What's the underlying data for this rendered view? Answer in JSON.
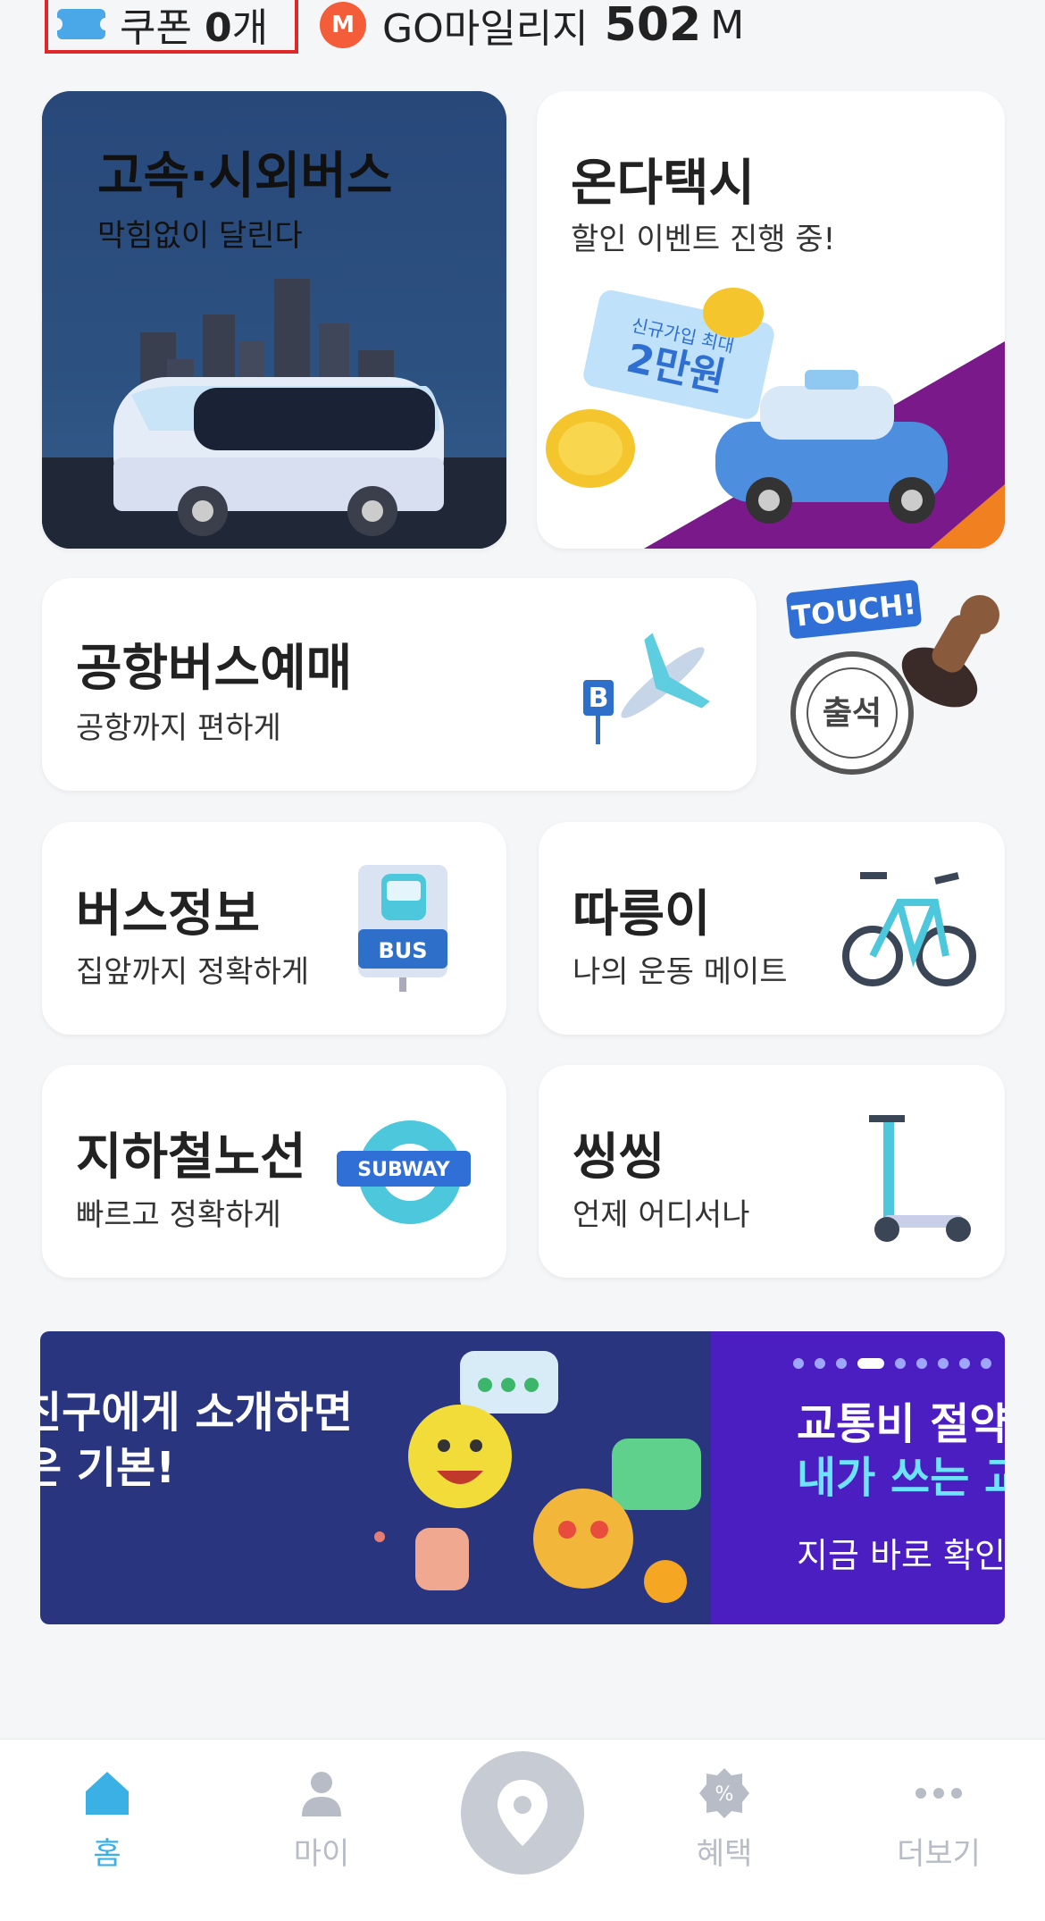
{
  "header": {
    "coupon_label": "쿠폰",
    "coupon_count": "0",
    "coupon_unit": "개",
    "mileage_label": "GO마일리지",
    "mileage_value": "502",
    "mileage_unit": "M"
  },
  "cards": {
    "express_bus": {
      "title": "고속·시외버스",
      "subtitle": "막힘없이 달린다"
    },
    "onda_taxi": {
      "title": "온다택시",
      "subtitle": "할인 이벤트 진행 중!",
      "ticket_line1": "신규가입 최대",
      "ticket_line2": "2만원"
    },
    "airport_bus": {
      "title": "공항버스예매",
      "subtitle": "공항까지 편하게",
      "sign_letter": "B"
    },
    "attendance": {
      "touch_label": "TOUCH!",
      "stamp_label": "출석"
    },
    "bus_info": {
      "title": "버스정보",
      "subtitle": "집앞까지 정확하게",
      "sign_label": "BUS"
    },
    "bike": {
      "title": "따릉이",
      "subtitle": "나의 운동 메이트"
    },
    "subway": {
      "title": "지하철노선",
      "subtitle": "빠르고 정확하게",
      "sign_label": "SUBWAY"
    },
    "scooter": {
      "title": "씽씽",
      "subtitle": "언제 어디서나"
    }
  },
  "banner": {
    "left_line1": "친구에게 소개하면",
    "left_line2": "은 기본!",
    "right_line1": "교통비 절약 꿀",
    "right_line2": "내가 쓰는 교통",
    "right_line3": "지금 바로 확인하기",
    "page_count": 9,
    "active_page": 4
  },
  "tabbar": {
    "home": "홈",
    "my": "마이",
    "benefit": "혜택",
    "more": "더보기"
  },
  "colors": {
    "accent": "#3ab0e4",
    "inactive": "#b7bcc6",
    "coupon_highlight": "#e02828",
    "mileage_badge": "#f35d3a",
    "banner_left": "#2a3580",
    "banner_right": "#4b1ec2"
  }
}
